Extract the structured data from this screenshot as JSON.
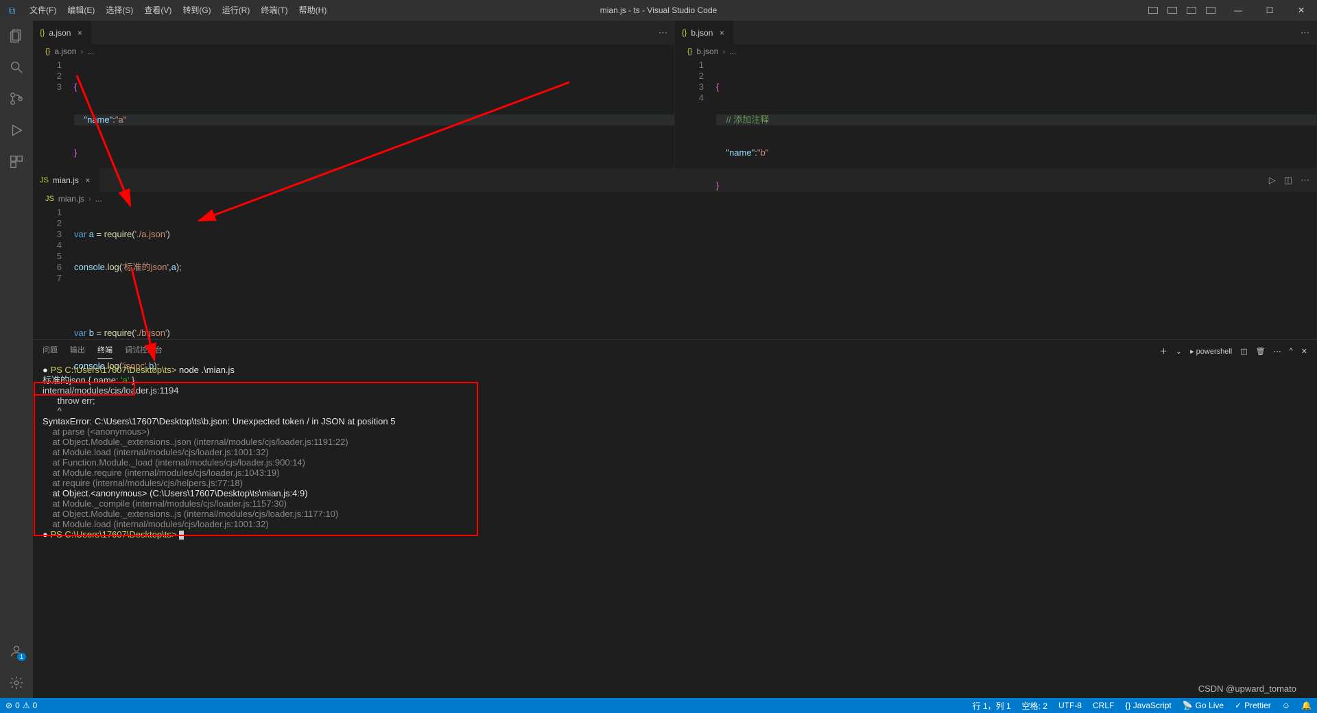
{
  "window": {
    "title": "mian.js - ts - Visual Studio Code"
  },
  "menu": {
    "file": "文件(F)",
    "edit": "编辑(E)",
    "select": "选择(S)",
    "view": "查看(V)",
    "go": "转到(G)",
    "run": "运行(R)",
    "terminal": "终端(T)",
    "help": "帮助(H)"
  },
  "activity": {
    "account_badge": "1"
  },
  "editor_a": {
    "tab": "a.json",
    "crumb": "a.json",
    "crumb_tail": "...",
    "lines": [
      "1",
      "2",
      "3"
    ],
    "l1_open": "{",
    "l2_key": "\"name\"",
    "l2_colon": ":",
    "l2_val": "\"a\"",
    "l3_close": "}"
  },
  "editor_b": {
    "tab": "b.json",
    "crumb": "b.json",
    "crumb_tail": "...",
    "lines": [
      "1",
      "2",
      "3",
      "4"
    ],
    "l1_open": "{",
    "l2_comment": "// 添加注释",
    "l3_key": "\"name\"",
    "l3_colon": ":",
    "l3_val": "\"b\"",
    "l4_close": "}"
  },
  "editor_main": {
    "tab": "mian.js",
    "crumb": "mian.js",
    "crumb_tail": "...",
    "lines": [
      "1",
      "2",
      "3",
      "4",
      "5",
      "6",
      "7"
    ],
    "l1": {
      "var": "var",
      "a": "a",
      "eq": " = ",
      "req": "require",
      "arg": "'./a.json'"
    },
    "l2": {
      "obj": "console",
      "dot": ".",
      "log": "log",
      "arg1": "'标准的json'",
      "comma": ",",
      "argv": "a"
    },
    "l4": {
      "var": "var",
      "a": "b",
      "eq": " = ",
      "req": "require",
      "arg": "'./b.json'"
    },
    "l5": {
      "obj": "console",
      "dot": ".",
      "log": "log",
      "arg1": "'jsonc'",
      "comma": ",",
      "argv": "b"
    }
  },
  "panel": {
    "problems": "问题",
    "output": "输出",
    "terminal_tab": "终端",
    "debug_console": "调试控制台",
    "shell": "powershell"
  },
  "terminal": {
    "prefix1": "PS C:\\Users\\17607\\Desktop\\ts>",
    "cmd1": " node .\\mian.js",
    "out1": "标准的json { name: ",
    "out1_val": "'a'",
    "out1_end": " }",
    "line_loader": "internal/modules/cjs/loader.js:1194",
    "throw": "      throw err;",
    "caret": "      ^",
    "blank": "",
    "err_head": "SyntaxError: C:\\Users\\17607\\Desktop\\ts\\b.json: Unexpected token / in JSON at position 5",
    "st1": "    at parse (<anonymous>)",
    "st2": "    at Object.Module._extensions..json (internal/modules/cjs/loader.js:1191:22)",
    "st3": "    at Module.load (internal/modules/cjs/loader.js:1001:32)",
    "st4": "    at Function.Module._load (internal/modules/cjs/loader.js:900:14)",
    "st5": "    at Module.require (internal/modules/cjs/loader.js:1043:19)",
    "st6": "    at require (internal/modules/cjs/helpers.js:77:18)",
    "st7": "    at Object.<anonymous> (C:\\Users\\17607\\Desktop\\ts\\mian.js:4:9)",
    "st8": "    at Module._compile (internal/modules/cjs/loader.js:1157:30)",
    "st9": "    at Object.Module._extensions..js (internal/modules/cjs/loader.js:1177:10)",
    "st10": "    at Module.load (internal/modules/cjs/loader.js:1001:32)",
    "prefix2": "PS C:\\Users\\17607\\Desktop\\ts>"
  },
  "status": {
    "errors": "0",
    "warnings": "0",
    "ln_col": "行 1，列 1",
    "spaces": "空格: 2",
    "encoding": "UTF-8",
    "eol": "CRLF",
    "lang": "{} JavaScript",
    "golive": "Go Live",
    "prettier": "Prettier",
    "bell": "",
    "feedback": ""
  },
  "watermark": "CSDN @upward_tomato"
}
